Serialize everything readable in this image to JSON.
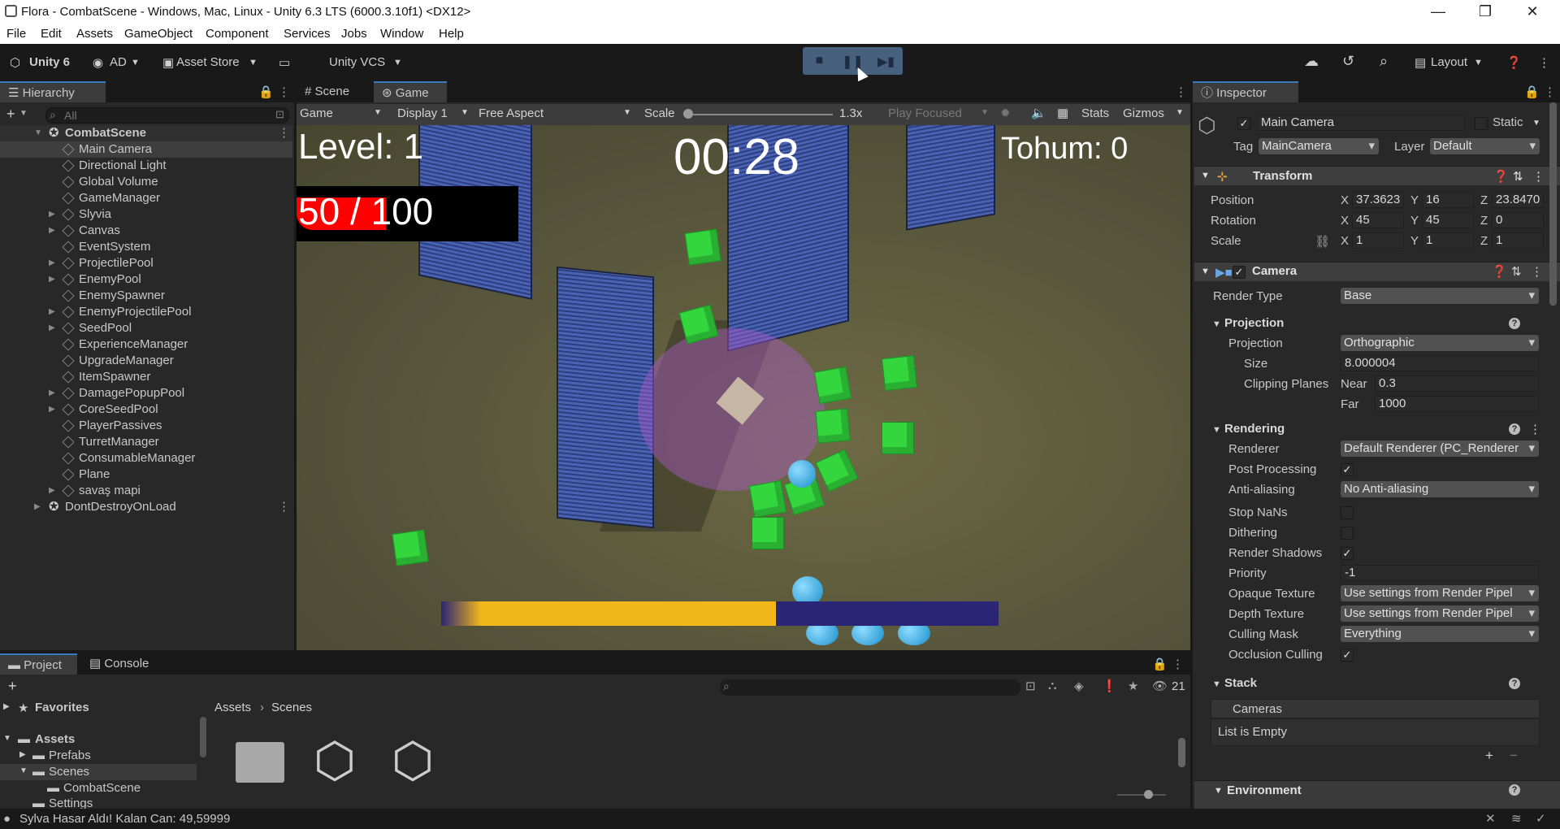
{
  "window": {
    "title": "Flora - CombatScene - Windows, Mac, Linux - Unity 6.3 LTS (6000.3.10f1) <DX12>"
  },
  "menu": [
    "File",
    "Edit",
    "Assets",
    "GameObject",
    "Component",
    "Services",
    "Jobs",
    "Window",
    "Help"
  ],
  "toolbar": {
    "unity": "Unity 6",
    "account": "AD",
    "asset_store": "Asset Store",
    "vcs": "Unity VCS",
    "layout": "Layout"
  },
  "hierarchy": {
    "tab": "Hierarchy",
    "search_placeholder": "All",
    "scene": "CombatScene",
    "items": [
      {
        "label": "Main Camera"
      },
      {
        "label": "Directional Light"
      },
      {
        "label": "Global Volume"
      },
      {
        "label": "GameManager"
      },
      {
        "label": "Slyvia"
      },
      {
        "label": "Canvas"
      },
      {
        "label": "EventSystem"
      },
      {
        "label": "ProjectilePool"
      },
      {
        "label": "EnemyPool"
      },
      {
        "label": "EnemySpawner"
      },
      {
        "label": "EnemyProjectilePool"
      },
      {
        "label": "SeedPool"
      },
      {
        "label": "ExperienceManager"
      },
      {
        "label": "UpgradeManager"
      },
      {
        "label": "ItemSpawner"
      },
      {
        "label": "DamagePopupPool"
      },
      {
        "label": "CoreSeedPool"
      },
      {
        "label": "PlayerPassives"
      },
      {
        "label": "TurretManager"
      },
      {
        "label": "ConsumableManager"
      },
      {
        "label": "Plane"
      },
      {
        "label": "savaş mapi"
      }
    ],
    "dontdestroy": "DontDestroyOnLoad"
  },
  "viewtabs": {
    "scene": "Scene",
    "game": "Game"
  },
  "gamebar": {
    "mode": "Game",
    "display": "Display 1",
    "aspect": "Free Aspect",
    "scale_label": "Scale",
    "scale_value": "1.3x",
    "play_focused": "Play Focused",
    "stats": "Stats",
    "gizmos": "Gizmos"
  },
  "hud": {
    "level": "Level: 1",
    "timer": "00:28",
    "tohum": "Tohum: 0",
    "hp": "50 / 100",
    "hp_fraction": 0.5,
    "xp_fraction": 0.6
  },
  "inspector": {
    "tab": "Inspector",
    "object_name": "Main Camera",
    "static": "Static",
    "tag_label": "Tag",
    "tag": "MainCamera",
    "layer_label": "Layer",
    "layer": "Default",
    "transform": {
      "title": "Transform",
      "position_label": "Position",
      "rotation_label": "Rotation",
      "scale_label": "Scale",
      "px": "37.3623",
      "py": "16",
      "pz": "23.8470",
      "rx": "45",
      "ry": "45",
      "rz": "0",
      "sx": "1",
      "sy": "1",
      "sz": "1"
    },
    "camera": {
      "title": "Camera",
      "render_type_label": "Render Type",
      "render_type": "Base",
      "projection_section": "Projection",
      "projection_label": "Projection",
      "projection": "Orthographic",
      "size_label": "Size",
      "size": "8.000004",
      "clipping_label": "Clipping Planes",
      "near_label": "Near",
      "near": "0.3",
      "far_label": "Far",
      "far": "1000",
      "rendering_section": "Rendering",
      "renderer_label": "Renderer",
      "renderer": "Default Renderer (PC_Renderer",
      "post_label": "Post Processing",
      "aa_label": "Anti-aliasing",
      "aa": "No Anti-aliasing",
      "stopnans_label": "Stop NaNs",
      "dithering_label": "Dithering",
      "shadows_label": "Render Shadows",
      "priority_label": "Priority",
      "priority": "-1",
      "opaque_label": "Opaque Texture",
      "opaque": "Use settings from Render Pipel",
      "depth_label": "Depth Texture",
      "depth": "Use settings from Render Pipel",
      "culling_label": "Culling Mask",
      "culling": "Everything",
      "occlusion_label": "Occlusion Culling",
      "stack_section": "Stack",
      "cameras_label": "Cameras",
      "list_empty": "List is Empty",
      "environment_section": "Environment"
    }
  },
  "project": {
    "tab_project": "Project",
    "tab_console": "Console",
    "favorites": "Favorites",
    "assets": "Assets",
    "prefabs": "Prefabs",
    "scenes": "Scenes",
    "combatscene": "CombatScene",
    "settings": "Settings",
    "breadcrumb_root": "Assets",
    "breadcrumb_leaf": "Scenes",
    "count": "21"
  },
  "status": {
    "message": "Sylva Hasar Aldı! Kalan Can: 49,59999"
  }
}
